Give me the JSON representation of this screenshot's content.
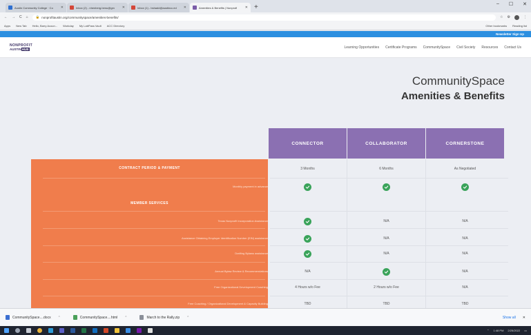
{
  "browser": {
    "tabs": [
      {
        "label": "Austin Community College · Co",
        "color": "#2f6fd0",
        "active": false
      },
      {
        "label": "Inbox (2) - nhenberg.benu@gm",
        "color": "#d44638",
        "active": false
      },
      {
        "label": "Inbox (1) - bshadd@austincc.ed",
        "color": "#d44638",
        "active": false
      },
      {
        "label": "Amenities & Benefits | Nonprofi",
        "color": "#7a5ca8",
        "active": true
      }
    ],
    "new_tab": "+",
    "window_controls": [
      "–",
      "☐",
      "✕"
    ],
    "nav_buttons": [
      "←",
      "→",
      "C",
      "⌂"
    ],
    "url": "nonprofitaustin.org/communityspace/amenities-benefits/",
    "bookmarks": [
      "Apps",
      "New Tab",
      "Hello, Barry Acoun...",
      "Workday",
      "My LabPass Vault",
      "ACC Directory"
    ],
    "bookmarks_right": [
      "Other bookmarks",
      "Reading list"
    ]
  },
  "site": {
    "promo": "Newsletter Sign Up",
    "logo_top": "NONPROFIT",
    "logo_bottom_a": "AUSTIN",
    "logo_bottom_b": "HUB",
    "nav": [
      "Learning Opportunities",
      "Certificate Programs",
      "CommunitySpace",
      "Civil Society",
      "Resources",
      "Contact Us"
    ]
  },
  "heading": {
    "line1": "CommunitySpace",
    "line2": "Amenities & Benefits"
  },
  "table": {
    "columns": [
      "CONNECTOR",
      "COLLABORATOR",
      "CORNERSTONE"
    ],
    "sections": [
      "CONTRACT PERIOD & PAYMENT",
      "MEMBER SERVICES"
    ],
    "rows": [
      {
        "label": "Monthly payment in advance",
        "values": [
          "check",
          "check",
          "check"
        ]
      },
      {
        "label": "Texas Nonprofit Incorporation Assistance",
        "values": [
          "check",
          "N/A",
          "N/A"
        ]
      },
      {
        "label": "Assistance Obtaining Employer Identification Number (EIN) assistance",
        "values": [
          "check",
          "N/A",
          "N/A"
        ]
      },
      {
        "label": "Drafting Bylaws assistance",
        "values": [
          "check",
          "N/A",
          "N/A"
        ]
      },
      {
        "label": "Annual Bylaw Review & Recommendations",
        "values": [
          "N/A",
          "check",
          "N/A"
        ]
      },
      {
        "label": "Free Organizational Development Coaching",
        "values": [
          "4 Hours w/o Fee",
          "2 Hours w/o Fee",
          "N/A"
        ]
      },
      {
        "label": "Free Coaching / Organizational Development & Capacity Building",
        "values": [
          "TBD",
          "TBD",
          "TBD"
        ]
      }
    ],
    "contract_values": [
      "3 Months",
      "6 Months",
      "As Negotiated"
    ]
  },
  "downloads": {
    "items": [
      "CommunitySpace....docx",
      "CommunitySpace....html",
      "March to the Rally.zip"
    ],
    "show_all": "Show all",
    "close": "✕"
  },
  "taskbar": {
    "time": "1:48 PM",
    "date": "2/25/2022"
  },
  "colors": {
    "accent_purple": "#8b70b2",
    "accent_orange": "#f07d4c",
    "check_green": "#3aa35a",
    "promo_blue": "#2c8fe0"
  }
}
